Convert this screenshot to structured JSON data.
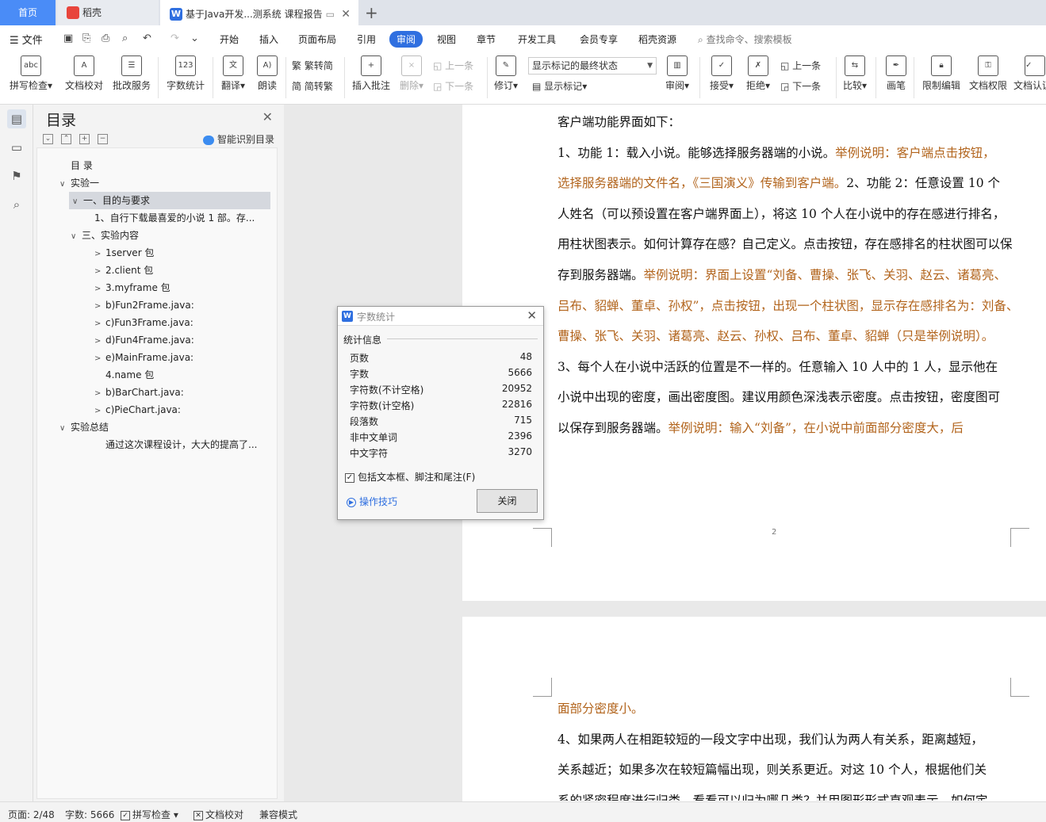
{
  "tabs": {
    "home": "首页",
    "daoke": "稻壳",
    "doc": "基于Java开发...测系统 课程报告",
    "add": "+"
  },
  "menu": {
    "file": "文件",
    "items": [
      "开始",
      "插入",
      "页面布局",
      "引用",
      "审阅",
      "视图",
      "章节",
      "开发工具",
      "会员专享",
      "稻壳资源"
    ],
    "active": "审阅",
    "search": "查找命令、搜索模板"
  },
  "ribbon": {
    "spellcheck": "拼写检查",
    "doccheck": "文档校对",
    "batch": "批改服务",
    "wordcount": "字数统计",
    "translate": "翻译",
    "read": "朗读",
    "trad": "繁转简",
    "simp": "简转繁",
    "insert_comment": "插入批注",
    "delete": "删除",
    "prev": "上一条",
    "next": "下一条",
    "revise": "修订",
    "markup_select": "显示标记的最终状态",
    "show_markup": "显示标记",
    "review": "审阅",
    "accept": "接受",
    "reject": "拒绝",
    "prev2": "上一条",
    "next2": "下一条",
    "compare": "比较",
    "pen": "画笔",
    "restrict": "限制编辑",
    "permission": "文档权限",
    "certify": "文档认证"
  },
  "toc": {
    "title": "目录",
    "smart": "智能识别目录",
    "items": [
      {
        "label": "目 录",
        "arrow": ""
      },
      {
        "label": "实验一",
        "arrow": "∨"
      },
      {
        "label": "一、目的与要求",
        "arrow": "∨"
      },
      {
        "label": "1、自行下载最喜爱的小说 1 部。存...",
        "arrow": ""
      },
      {
        "label": "三、实验内容",
        "arrow": "∨"
      },
      {
        "label": "1server 包",
        "arrow": ">"
      },
      {
        "label": "2.client 包",
        "arrow": ">"
      },
      {
        "label": "3.myframe 包",
        "arrow": ">"
      },
      {
        "label": "b)Fun2Frame.java:",
        "arrow": ">"
      },
      {
        "label": "c)Fun3Frame.java:",
        "arrow": ">"
      },
      {
        "label": "d)Fun4Frame.java:",
        "arrow": ">"
      },
      {
        "label": "e)MainFrame.java:",
        "arrow": ">"
      },
      {
        "label": "4.name 包",
        "arrow": ""
      },
      {
        "label": "b)BarChart.java:",
        "arrow": ">"
      },
      {
        "label": "c)PieChart.java:",
        "arrow": ">"
      },
      {
        "label": "实验总结",
        "arrow": "∨"
      },
      {
        "label": "通过这次课程设计，大大的提高了...",
        "arrow": ""
      }
    ]
  },
  "document": {
    "p1_lines": [
      {
        "text": "客户端功能界面如下：",
        "accent": ""
      },
      {
        "text": "1、功能 1：载入小说。能够选择服务器端的小说。",
        "accent": "举例说明：客户端点击按钮，"
      },
      {
        "text": "",
        "accent": "选择服务器端的文件名，《三国演义》传输到客户端。",
        "tail": "2、功能 2：任意设置 10 个"
      },
      {
        "text": "人姓名（可以预设置在客户端界面上），将这 10 个人在小说中的存在感进行排名，",
        "accent": ""
      },
      {
        "text": "用柱状图表示。如何计算存在感？自己定义。点击按钮，存在感排名的柱状图可以保",
        "accent": ""
      },
      {
        "text": "存到服务器端。",
        "accent": "举例说明：界面上设置“刘备、曹操、张飞、关羽、赵云、诸葛亮、"
      },
      {
        "text": "",
        "accent": "吕布、貂蝉、董卓、孙权”，点击按钮，出现一个柱状图，显示存在感排名为：刘备、"
      },
      {
        "text": "",
        "accent": "曹操、张飞、关羽、诸葛亮、赵云、孙权、吕布、董卓、貂蝉（只是举例说明）。"
      },
      {
        "text": "3、每个人在小说中活跃的位置是不一样的。任意输入 10 人中的 1 人，显示他在",
        "accent": ""
      },
      {
        "text": "小说中出现的密度，画出密度图。建议用颜色深浅表示密度。点击按钮，密度图可",
        "accent": ""
      },
      {
        "text": "以保存到服务器端。",
        "accent": "举例说明：输入“刘备”，在小说中前面部分密度大，后"
      }
    ],
    "page_number": "2",
    "p2_lines": [
      {
        "text": "",
        "accent": "面部分密度小。"
      },
      {
        "text": "4、如果两人在相距较短的一段文字中出现，我们认为两人有关系，距离越短，",
        "accent": ""
      },
      {
        "text": "关系越近；如果多次在较短篇幅出现，则关系更近。对这 10 个人，根据他们关",
        "accent": ""
      },
      {
        "text": "系的紧密程度进行归类，看看可以归为哪几类？并用图形形式直观表示。如何定",
        "accent": ""
      }
    ]
  },
  "dialog": {
    "title": "字数统计",
    "section": "统计信息",
    "rows": [
      {
        "label": "页数",
        "value": "48"
      },
      {
        "label": "字数",
        "value": "5666"
      },
      {
        "label": "字符数(不计空格)",
        "value": "20952"
      },
      {
        "label": "字符数(计空格)",
        "value": "22816"
      },
      {
        "label": "段落数",
        "value": "715"
      },
      {
        "label": "非中文单词",
        "value": "2396"
      },
      {
        "label": "中文字符",
        "value": "3270"
      }
    ],
    "include_label": "包括文本框、脚注和尾注(F)",
    "include_checked": true,
    "tips": "操作技巧",
    "close": "关闭"
  },
  "status": {
    "page": "页面: 2/48",
    "words": "字数: 5666",
    "spell": "拼写检查",
    "doccheck": "文档校对",
    "compat": "兼容模式"
  }
}
